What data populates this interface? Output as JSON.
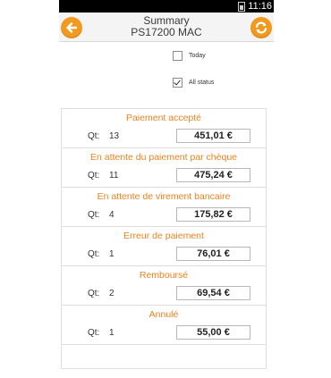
{
  "status_bar": {
    "time": "11:16",
    "battery_icon": "battery-icon"
  },
  "header": {
    "title": "Summary",
    "subtitle": "PS17200 MAC",
    "back_icon": "arrow-left-icon",
    "refresh_icon": "refresh-icon",
    "accent_color": "#f29a1f"
  },
  "filters": {
    "today": {
      "label": "Today",
      "checked": false
    },
    "all_status": {
      "label": "All status",
      "checked": true
    }
  },
  "qt_label": "Qt:",
  "statuses": [
    {
      "name": "Paiement accepté",
      "qt": "13",
      "amount": "451,01 €"
    },
    {
      "name": "En attente du paiement par chèque",
      "qt": "11",
      "amount": "475,24 €"
    },
    {
      "name": "En attente de virement bancaire",
      "qt": "4",
      "amount": "175,82 €"
    },
    {
      "name": "Erreur de paiement",
      "qt": "1",
      "amount": "76,01 €"
    },
    {
      "name": "Remboursé",
      "qt": "2",
      "amount": "69,54 €"
    },
    {
      "name": "Annulé",
      "qt": "1",
      "amount": "55,00 €"
    }
  ]
}
